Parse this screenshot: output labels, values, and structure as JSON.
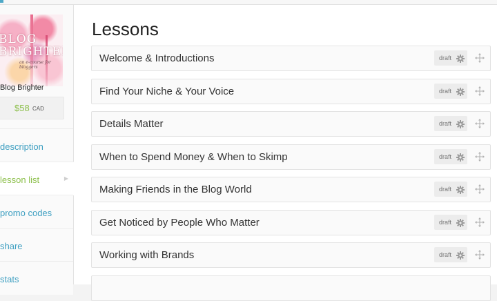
{
  "sidebar": {
    "cover": {
      "title_line1": "BLOG",
      "title_line2": "BRIGHTER",
      "subtitle": "an e-course for bloggers"
    },
    "course_title": "Blog Brighter",
    "price": "$58",
    "currency": "CAD",
    "nav": [
      {
        "label": "description",
        "active": false
      },
      {
        "label": "lesson list",
        "active": true
      },
      {
        "label": "promo codes",
        "active": false
      },
      {
        "label": "share",
        "active": false
      },
      {
        "label": "stats",
        "active": false
      }
    ]
  },
  "main": {
    "title": "Lessons",
    "lessons": [
      {
        "title": "Welcome & Introductions",
        "status": "draft"
      },
      {
        "title": "Find Your Niche & Your Voice",
        "status": "draft"
      },
      {
        "title": "Details Matter",
        "status": "draft"
      },
      {
        "title": "When to Spend Money & When to Skimp",
        "status": "draft"
      },
      {
        "title": "Making Friends in the Blog World",
        "status": "draft"
      },
      {
        "title": "Get Noticed by People Who Matter",
        "status": "draft"
      },
      {
        "title": "Working with Brands",
        "status": "draft"
      }
    ],
    "icons": {
      "settings": "gear-icon",
      "reorder": "move-icon"
    }
  },
  "colors": {
    "link": "#3e9fc1",
    "active": "#8cbf4b",
    "price": "#8cbf4b"
  }
}
